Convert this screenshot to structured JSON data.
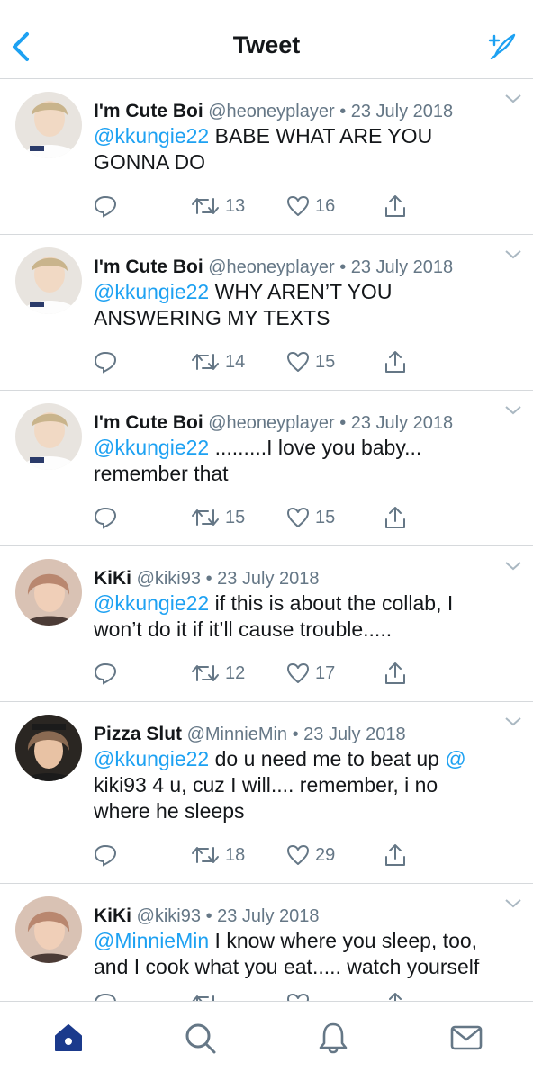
{
  "header": {
    "title": "Tweet"
  },
  "tweets": [
    {
      "name": "I'm Cute Boi",
      "handle": "@heoneyplayer",
      "date": "23 July 2018",
      "mention": "@kkungie22",
      "text_line1": " BABE WHAT ARE YOU",
      "text_line2": "GONNA DO",
      "retweets": "13",
      "likes": "16",
      "avatar_color": "#c9b48c"
    },
    {
      "name": "I'm Cute Boi",
      "handle": "@heoneyplayer",
      "date": "23 July 2018",
      "mention": "@kkungie22",
      "text_line1": " WHY AREN’T YOU",
      "text_line2": "ANSWERING MY TEXTS",
      "retweets": "14",
      "likes": "15",
      "avatar_color": "#c9b48c"
    },
    {
      "name": "I'm Cute Boi",
      "handle": "@heoneyplayer",
      "date": "23 July 2018",
      "mention": "@kkungie22",
      "text_line1": " .........I love you baby...",
      "text_line2": "remember that",
      "retweets": "15",
      "likes": "15",
      "avatar_color": "#c9b48c"
    },
    {
      "name": "KiKi",
      "handle": "@kiki93",
      "date": "23 July 2018",
      "mention": "@kkungie22",
      "text_line1": " if this is about the collab, I",
      "text_line2": "won’t do it if it’ll cause trouble.....",
      "retweets": "12",
      "likes": "17",
      "avatar_color": "#b9876f"
    },
    {
      "name": "Pizza Slut",
      "handle": "@MinnieMin",
      "date": "23 July 2018",
      "mention": "@kkungie22",
      "text_line1": " do u need me to beat up ",
      "text_line1_mention2": "@",
      "text_line2": "kiki93 4 u, cuz I will.... remember, i no",
      "text_line3": "where he sleeps",
      "retweets": "18",
      "likes": "29",
      "avatar_color": "#8a6a52"
    },
    {
      "name": "KiKi",
      "handle": "@kiki93",
      "date": "23 July 2018",
      "mention": "@MinnieMin",
      "text_line1": " I know where you sleep, too,",
      "text_line2": "and I cook what you eat..... watch yourself",
      "avatar_color": "#b9876f"
    }
  ],
  "tabbar": {
    "items": [
      "home-icon",
      "search-icon",
      "notifications-icon",
      "messages-icon"
    ]
  },
  "colors": {
    "accent": "#1da1f2",
    "secondary_text": "#657786",
    "divider": "#d6d9dc",
    "home_active": "#1b3a8c"
  }
}
